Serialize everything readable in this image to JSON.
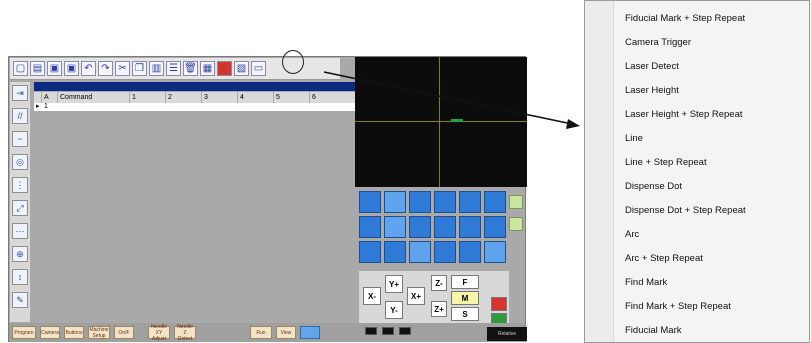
{
  "toolbar": {
    "icons": [
      "new-icon",
      "open-icon",
      "save-icon",
      "save-as-icon",
      "undo-icon",
      "redo-icon",
      "cut-icon",
      "copy-icon",
      "paste-icon",
      "list-icon",
      "delete-icon",
      "frame-icon",
      "crosshair-icon",
      "insert-icon",
      "window-icon"
    ]
  },
  "table": {
    "headers": [
      "",
      "A",
      "Command",
      "1",
      "2",
      "3",
      "4",
      "5",
      "6"
    ],
    "rows": [
      [
        "1",
        "",
        "",
        "",
        "",
        "",
        "",
        "",
        ""
      ]
    ]
  },
  "jog": {
    "x_minus": "X-",
    "y_plus": "Y+",
    "x_plus": "X+",
    "y_minus": "Y-",
    "z_minus": "Z-",
    "z_plus": "Z+",
    "f": "F",
    "m": "M",
    "s": "S"
  },
  "readout": {
    "relative": "Relative"
  },
  "bottom_buttons": [
    "Program",
    "Camera",
    "Buttons",
    "Machine Setup",
    "On/F",
    "Needle XY Adjust",
    "Needle Z Detect",
    "Run",
    "View",
    ""
  ],
  "menu": {
    "items": [
      "Fiducial Mark + Step  Repeat",
      "Camera Trigger",
      "Laser Detect",
      "Laser Height",
      "Laser Height + Step  Repeat",
      "Line",
      "Line + Step  Repeat",
      "Dispense Dot",
      "Dispense Dot + Step  Repeat",
      "Arc",
      "Arc + Step  Repeat",
      "Find Mark",
      "Find Mark + Step  Repeat",
      "Fiducial Mark"
    ]
  },
  "colors": {
    "table_band": "#0b2a83",
    "preview_bg": "#0c0c0c",
    "crosshair": "#8a7d0f",
    "grid_button": "#2e7ad6",
    "bottom_button": "#f3e3c7"
  }
}
